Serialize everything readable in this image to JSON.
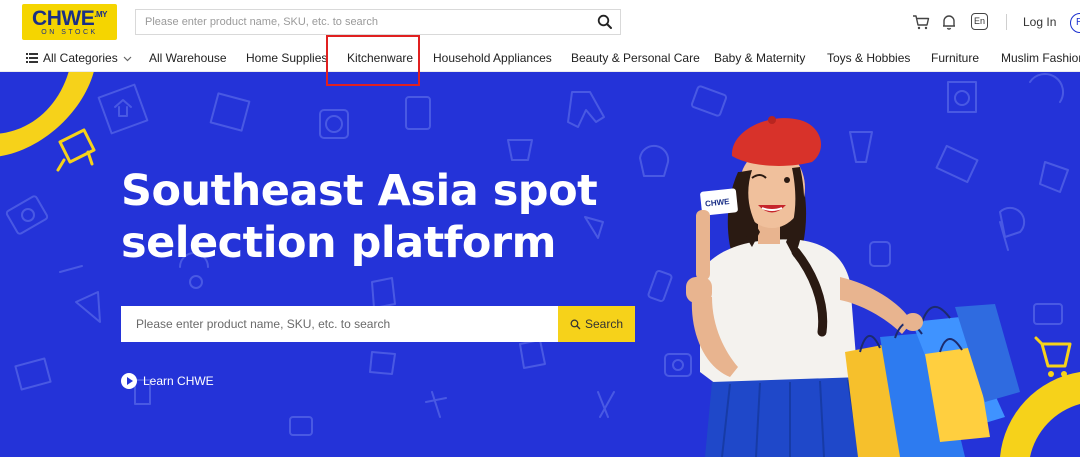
{
  "header": {
    "logo": {
      "main": "CHWE",
      "suffix": ".MY",
      "tagline": "ON STOCK"
    },
    "search": {
      "placeholder": "Please enter product name, SKU, etc. to search",
      "icon": "search-icon"
    },
    "icons": [
      "cart-icon",
      "bell-icon"
    ],
    "language": "En",
    "login_label": "Log In",
    "register_glyph": "R"
  },
  "nav": {
    "all_categories": "All Categories",
    "items": [
      "All Warehouse",
      "Home Supplies",
      "Kitchenware",
      "Household Appliances",
      "Beauty & Personal Care",
      "Baby & Maternity",
      "Toys & Hobbies",
      "Furniture",
      "Muslim Fashion"
    ],
    "highlighted": "Kitchenware"
  },
  "hero": {
    "title_line1": "Southeast Asia spot",
    "title_line2": "selection platform",
    "search": {
      "placeholder": "Please enter product name, SKU, etc. to search",
      "button_label": "Search"
    },
    "learn_label": "Learn CHWE",
    "card_text": "CHWE",
    "colors": {
      "background": "#2433d8",
      "accent": "#f6d21a",
      "hat": "#d8322a",
      "skirt": "#1f48c9"
    }
  },
  "colors": {
    "brand_yellow": "#f5d500",
    "brand_blue": "#1a2f86",
    "highlight_red": "#e02020"
  }
}
